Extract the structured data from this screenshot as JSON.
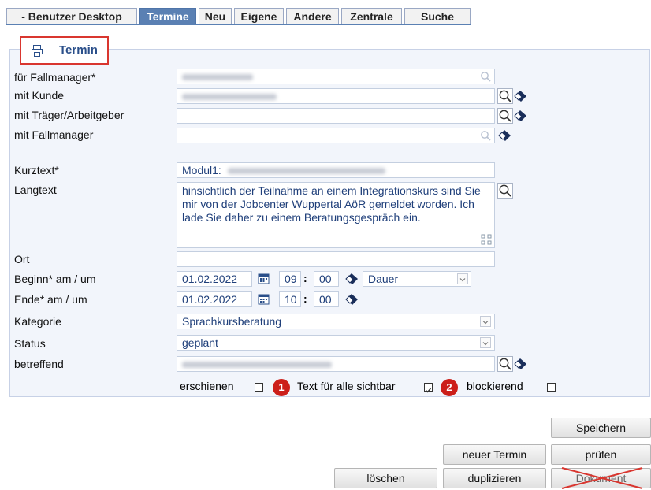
{
  "tabs": [
    {
      "label": "- Benutzer Desktop"
    },
    {
      "label": "Termine"
    },
    {
      "label": "Neu"
    },
    {
      "label": "Eigene"
    },
    {
      "label": "Andere"
    },
    {
      "label": "Zentrale"
    },
    {
      "label": "Suche"
    }
  ],
  "section": {
    "title": "Termin",
    "icon": "printer-icon"
  },
  "labels": {
    "fallmanager": "für Fallmanager*",
    "kunde": "mit Kunde",
    "traeger": "mit Träger/Arbeitgeber",
    "mit_fallmanager": "mit Fallmanager",
    "kurztext": "Kurztext*",
    "langtext": "Langtext",
    "ort": "Ort",
    "beginn": "Beginn* am / um",
    "ende": "Ende* am / um",
    "kategorie": "Kategorie",
    "status": "Status",
    "betreffend": "betreffend"
  },
  "fields": {
    "kurztext_prefix": "Modul1:",
    "langtext": "hinsichtlich der Teilnahme an einem Integrationskurs sind Sie mir von der Jobcenter Wuppertal AöR gemeldet worden. Ich lade Sie daher zu einem Beratungsgespräch ein.",
    "beginn_date": "01.02.2022",
    "beginn_hour": "09",
    "beginn_min": "00",
    "dauer": "Dauer",
    "ende_date": "01.02.2022",
    "ende_hour": "10",
    "ende_min": "00",
    "time_sep": ":",
    "kategorie": "Sprachkursberatung",
    "status": "geplant"
  },
  "checkboxes": {
    "erschienen": "erschienen",
    "text_sichtbar": "Text für alle sichtbar",
    "blockierend": "blockierend"
  },
  "badges": [
    "1",
    "2"
  ],
  "buttons": {
    "speichern": "Speichern",
    "neuer_termin": "neuer Termin",
    "pruefen": "prüfen",
    "loeschen": "löschen",
    "duplizieren": "duplizieren",
    "dokument": "Dokument"
  },
  "colors": {
    "accent": "#5a80b3",
    "badge": "#cc1f1a",
    "highlight_border": "#d9362f"
  }
}
